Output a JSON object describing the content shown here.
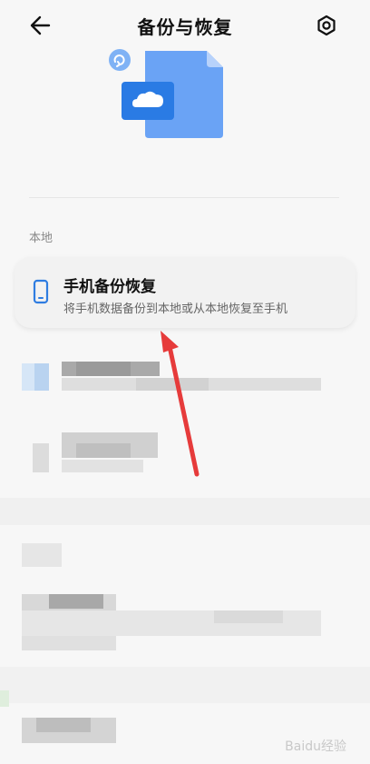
{
  "header": {
    "title": "备份与恢复",
    "back_icon": "arrow-left-icon",
    "settings_icon": "gear-icon"
  },
  "section": {
    "label": "本地"
  },
  "card": {
    "icon": "phone-icon",
    "title": "手机备份恢复",
    "subtitle": "将手机数据备份到本地或从本地恢复至手机"
  },
  "watermark": {
    "text": "Baidu经验"
  },
  "colors": {
    "accent": "#2f7de1",
    "arrow": "#e63b3b",
    "illus_light": "#8ab5f5",
    "illus_dark": "#2a7be4"
  }
}
